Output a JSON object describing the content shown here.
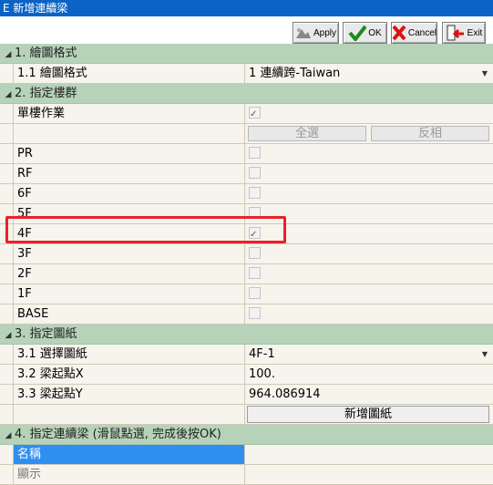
{
  "window": {
    "title": "E 新增連續梁"
  },
  "toolbar": {
    "apply_label": "Apply",
    "ok_label": "OK",
    "cancel_label": "Cancel",
    "exit_label": "Exit"
  },
  "sections": [
    {
      "title": "1. 繪圖格式"
    },
    {
      "title": "2. 指定樓群"
    },
    {
      "title": "3. 指定圖紙"
    },
    {
      "title": "4. 指定連續梁 (滑鼠點選, 完成後按OK)"
    }
  ],
  "s1": {
    "name": "1.1 繪圖格式",
    "value": "1 連續跨-Taiwan"
  },
  "s2": {
    "single_floor_label": "單樓作業",
    "single_floor_checked": true,
    "select_all": "全選",
    "invert": "反相",
    "floors": [
      {
        "name": "PR",
        "checked": false
      },
      {
        "name": "RF",
        "checked": false
      },
      {
        "name": "6F",
        "checked": false
      },
      {
        "name": "5F",
        "checked": false
      },
      {
        "name": "4F",
        "checked": true
      },
      {
        "name": "3F",
        "checked": false
      },
      {
        "name": "2F",
        "checked": false
      },
      {
        "name": "1F",
        "checked": false
      },
      {
        "name": "BASE",
        "checked": false
      }
    ]
  },
  "s3": {
    "sheet_name": "3.1 選擇圖紙",
    "sheet_value": "4F-1",
    "x_name": "3.2 梁起點X",
    "x_value": "100.",
    "y_name": "3.3 梁起點Y",
    "y_value": "964.086914",
    "add_sheet": "新增圖紙"
  },
  "s4": {
    "name_label": "名稱",
    "show_label": "顯示"
  },
  "colors": {
    "title_bar": "#0b63c5",
    "category": "#b6d3b9",
    "selected": "#2f8ff0",
    "highlight": "#e8212b"
  }
}
